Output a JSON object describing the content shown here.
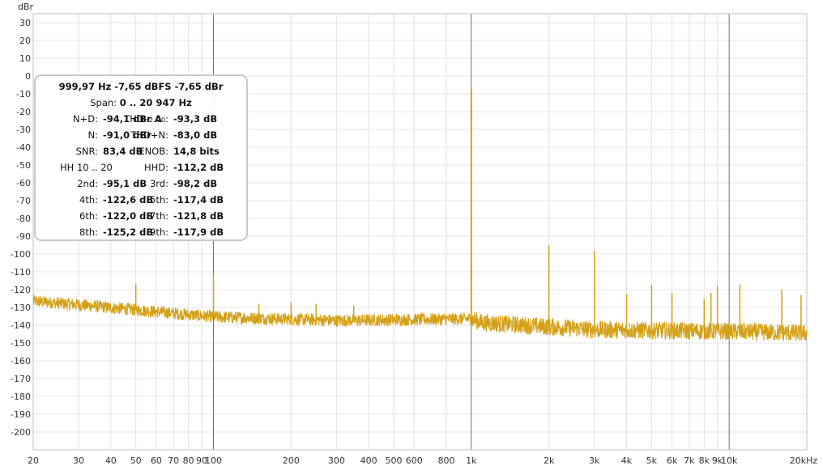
{
  "chart_data": {
    "type": "line",
    "ylabel": "dBr",
    "x_scale": "log",
    "xlim": [
      20,
      20000
    ],
    "ylim": [
      -210,
      35
    ],
    "y_ticks": [
      30,
      20,
      10,
      0,
      -10,
      -20,
      -30,
      -40,
      -50,
      -60,
      -70,
      -80,
      -90,
      -100,
      -110,
      -120,
      -130,
      -140,
      -150,
      -160,
      -170,
      -180,
      -190,
      -200
    ],
    "x_ticks": [
      20,
      30,
      40,
      50,
      60,
      70,
      80,
      90,
      100,
      200,
      300,
      400,
      500,
      600,
      800,
      1000,
      2000,
      3000,
      4000,
      5000,
      6000,
      7000,
      8000,
      9000,
      10000,
      20000
    ],
    "x_tick_labels": [
      "20",
      "30",
      "40",
      "50",
      "60",
      "70",
      "80",
      "90",
      "100",
      "200",
      "300",
      "400",
      "500",
      "600",
      "800",
      "1k",
      "2k",
      "3k",
      "4k",
      "5k",
      "6k",
      "7k",
      "8k",
      "9k",
      "10k",
      "20kHz"
    ],
    "grid": true,
    "series": [
      {
        "color": "#d4a017",
        "noise_floor_x": [
          20,
          50,
          100,
          300,
          1000,
          1100,
          3000,
          10000,
          20000
        ],
        "noise_floor_y": [
          -126,
          -131,
          -135,
          -137,
          -136,
          -138,
          -142,
          -143,
          -144
        ],
        "peaks_x": [
          50,
          100,
          150,
          200,
          250,
          350,
          1000,
          2000,
          3000,
          4000,
          5000,
          6000,
          8000,
          8500,
          9000,
          11000,
          16000,
          19000
        ],
        "peaks_y": [
          -117,
          -112,
          -128,
          -127,
          -128,
          -129,
          -7.65,
          -95.1,
          -98.2,
          -122.6,
          -117.4,
          -122.0,
          -125.2,
          -121.8,
          -117.9,
          -117,
          -120,
          -123
        ]
      }
    ]
  },
  "info_box": {
    "line1": "999,97 Hz  -7,65 dBFS  -7,65 dBr",
    "span_label": "Span: ",
    "span_value": "0 .. 20 947 Hz",
    "rows": [
      {
        "ll": "N+D:",
        "lv": "-94,1 dBr A",
        "rl": "THD",
        "rl_sub": "H2..20",
        "rl_tail": ":",
        "rv": "-93,3 dB"
      },
      {
        "ll": "N:",
        "lv": "-91,0 dBr",
        "rl": "THD+N:",
        "rv": "-83,0 dB"
      },
      {
        "ll": "SNR:",
        "lv": "83,4 dB",
        "rl": "ENOB:",
        "rv": "14,8 bits"
      },
      {
        "ll": "HH 10 .. 20",
        "lv": "",
        "rl": "HHD:",
        "rv": "-112,2 dB"
      },
      {
        "ll": "2nd:",
        "lv": "-95,1 dB",
        "rl": "3rd:",
        "rv": "-98,2 dB"
      },
      {
        "ll": "4th:",
        "lv": "-122,6 dB",
        "rl": "5th:",
        "rv": "-117,4 dB"
      },
      {
        "ll": "6th:",
        "lv": "-122,0 dB",
        "rl": "7th:",
        "rv": "-121,8 dB"
      },
      {
        "ll": "8th:",
        "lv": "-125,2 dB",
        "rl": "9th:",
        "rv": "-117,9 dB"
      }
    ]
  }
}
